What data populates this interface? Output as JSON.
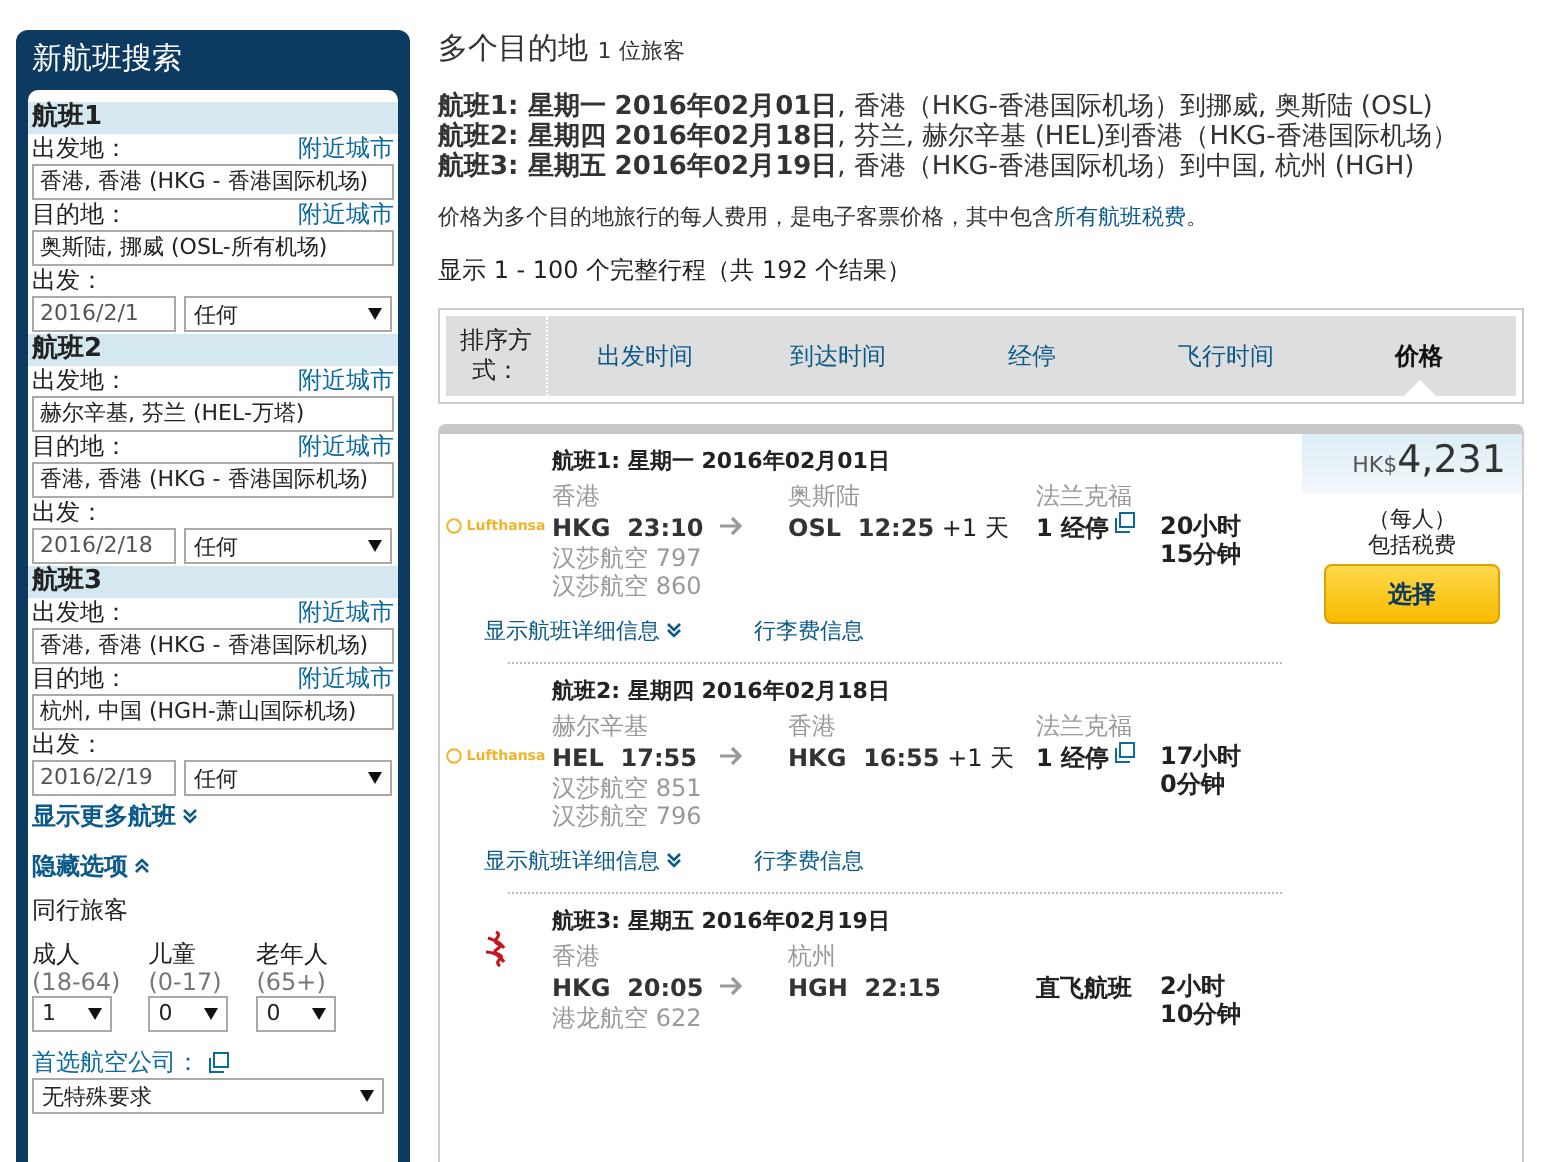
{
  "search_panel": {
    "title": "新航班搜索",
    "flights": [
      {
        "heading": "航班1",
        "from_label": "出发地：",
        "from_nearby": "附近城市",
        "from_value": "香港, 香港 (HKG - 香港国际机场)",
        "to_label": "目的地：",
        "to_nearby": "附近城市",
        "to_value": "奥斯陆, 挪威 (OSL-所有机场)",
        "date_label": "出发：",
        "date": "2016/2/1",
        "time": "任何"
      },
      {
        "heading": "航班2",
        "from_label": "出发地：",
        "from_nearby": "附近城市",
        "from_value": "赫尔辛基, 芬兰 (HEL-万塔)",
        "to_label": "目的地：",
        "to_nearby": "附近城市",
        "to_value": "香港, 香港 (HKG - 香港国际机场)",
        "date_label": "出发：",
        "date": "2016/2/18",
        "time": "任何"
      },
      {
        "heading": "航班3",
        "from_label": "出发地：",
        "from_nearby": "附近城市",
        "from_value": "香港, 香港 (HKG - 香港国际机场)",
        "to_label": "目的地：",
        "to_nearby": "附近城市",
        "to_value": "杭州, 中国 (HGH-萧山国际机场)",
        "date_label": "出发：",
        "date": "2016/2/19",
        "time": "任何"
      }
    ],
    "more_flights": "显示更多航班",
    "hide_options": {
      "label": "隐藏选项",
      "expanded": true
    },
    "travelers_label": "同行旅客",
    "travelers": [
      {
        "label": "成人",
        "range": "(18-64)",
        "value": "1"
      },
      {
        "label": "儿童",
        "range": "(0-17)",
        "value": "0"
      },
      {
        "label": "老年人",
        "range": "(65+)",
        "value": "0"
      }
    ],
    "airline_label": "首选航空公司：",
    "airline_value": "无特殊要求"
  },
  "results": {
    "title": "多个目的地",
    "travelers": "1 位旅客",
    "summary": [
      "**航班1: 星期一 2016年02月01日**, 香港（HKG-香港国际机场）到挪威, 奥斯陆 (OSL)",
      "**航班2: 星期四 2016年02月18日**, 芬兰, 赫尔辛基 (HEL)到香港（HKG-香港国际机场）",
      "**航班3: 星期五 2016年02月19日**, 香港（HKG-香港国际机场）到中国, 杭州 (HGH)"
    ],
    "price_note": "价格为多个目的地旅行的每人费用，是电子客票价格，其中包含",
    "price_note_link": "所有航班税费",
    "price_note_end": "。",
    "count": "显示 1 - 100 个完整行程（共 192 个结果）",
    "sort_label": "排序方式：",
    "sort_options": [
      {
        "label": "出发时间",
        "selected": false
      },
      {
        "label": "到达时间",
        "selected": false
      },
      {
        "label": "经停",
        "selected": false
      },
      {
        "label": "飞行时间",
        "selected": false
      },
      {
        "label": "价格",
        "selected": true
      }
    ],
    "itinerary": {
      "currency": "HK$",
      "price": "4,231",
      "per_person": "（每人）",
      "tax_note": "包括税费",
      "select_button": "选择",
      "legs": [
        {
          "kind": "lufthansa",
          "logo_text": "Lufthansa",
          "title": "航班1: 星期一 2016年02月01日",
          "from_city": "香港",
          "to_city": "奥斯陆",
          "via": "法兰克福",
          "from_code": "HKG",
          "from_time": "23:10",
          "to_code": "OSL",
          "to_time": "12:25",
          "day_offset": "+1 天",
          "stops": "1 经停",
          "stops_popup": true,
          "duration": "20小时 15分钟",
          "flights": [
            "汉莎航空 797",
            "汉莎航空 860"
          ],
          "details_link": "显示航班详细信息",
          "baggage_link": "行李费信息"
        },
        {
          "kind": "lufthansa",
          "logo_text": "Lufthansa",
          "title": "航班2: 星期四 2016年02月18日",
          "from_city": "赫尔辛基",
          "to_city": "香港",
          "via": "法兰克福",
          "from_code": "HEL",
          "from_time": "17:55",
          "to_code": "HKG",
          "to_time": "16:55",
          "day_offset": "+1 天",
          "stops": "1 经停",
          "stops_popup": true,
          "duration": "17小时 0分钟",
          "flights": [
            "汉莎航空 851",
            "汉莎航空 796"
          ],
          "details_link": "显示航班详细信息",
          "baggage_link": "行李费信息"
        },
        {
          "kind": "dragon",
          "title": "航班3: 星期五 2016年02月19日",
          "from_city": "香港",
          "to_city": "杭州",
          "from_code": "HKG",
          "from_time": "20:05",
          "to_code": "HGH",
          "to_time": "22:15",
          "stops": "直飞航班",
          "stops_popup": false,
          "duration": "2小时 10分钟",
          "flights": [
            "港龙航空 622"
          ]
        }
      ]
    }
  }
}
